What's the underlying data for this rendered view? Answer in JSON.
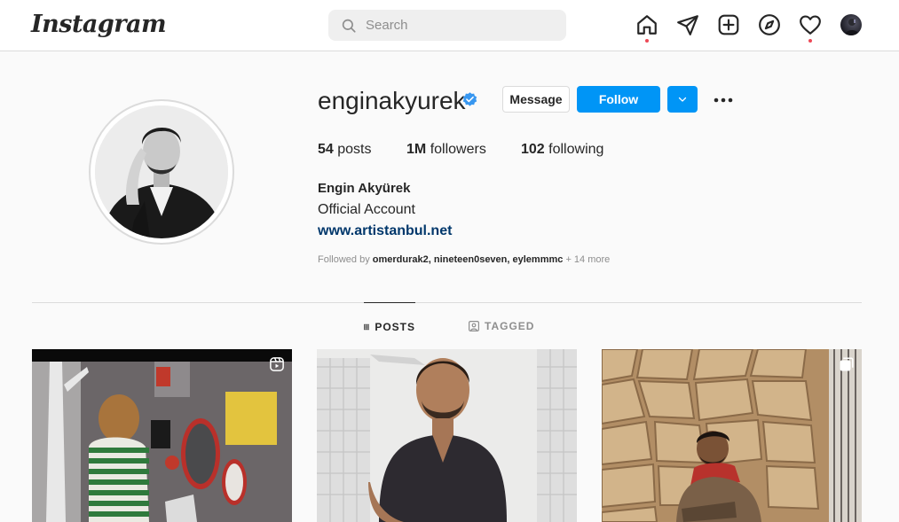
{
  "nav": {
    "logo": "Instagram",
    "search_placeholder": "Search",
    "icons": [
      "home-icon",
      "direct-icon",
      "new-post-icon",
      "explore-icon",
      "activity-icon"
    ]
  },
  "profile": {
    "username": "enginakyurek",
    "verified": true,
    "message_label": "Message",
    "follow_label": "Follow",
    "stats": {
      "posts_count": "54",
      "posts_label": "posts",
      "followers_count": "1M",
      "followers_label": "followers",
      "following_count": "102",
      "following_label": "following"
    },
    "full_name": "Engin Akyürek",
    "bio": "Official Account",
    "website": "www.artistanbul.net",
    "followed_by_prefix": "Followed by",
    "followed_by_names": "omerdurak2, nineteen0seven, eylemmmc",
    "followed_by_more": "+ 14 more"
  },
  "tabs": [
    {
      "label": "POSTS",
      "active": true
    },
    {
      "label": "TAGGED",
      "active": false
    }
  ],
  "posts": [
    {
      "type": "reel-icon"
    },
    {
      "type": "photo"
    },
    {
      "type": "carousel-icon"
    }
  ],
  "colors": {
    "accent": "#0095f6",
    "link": "#00376b",
    "notification": "#ed4956"
  }
}
